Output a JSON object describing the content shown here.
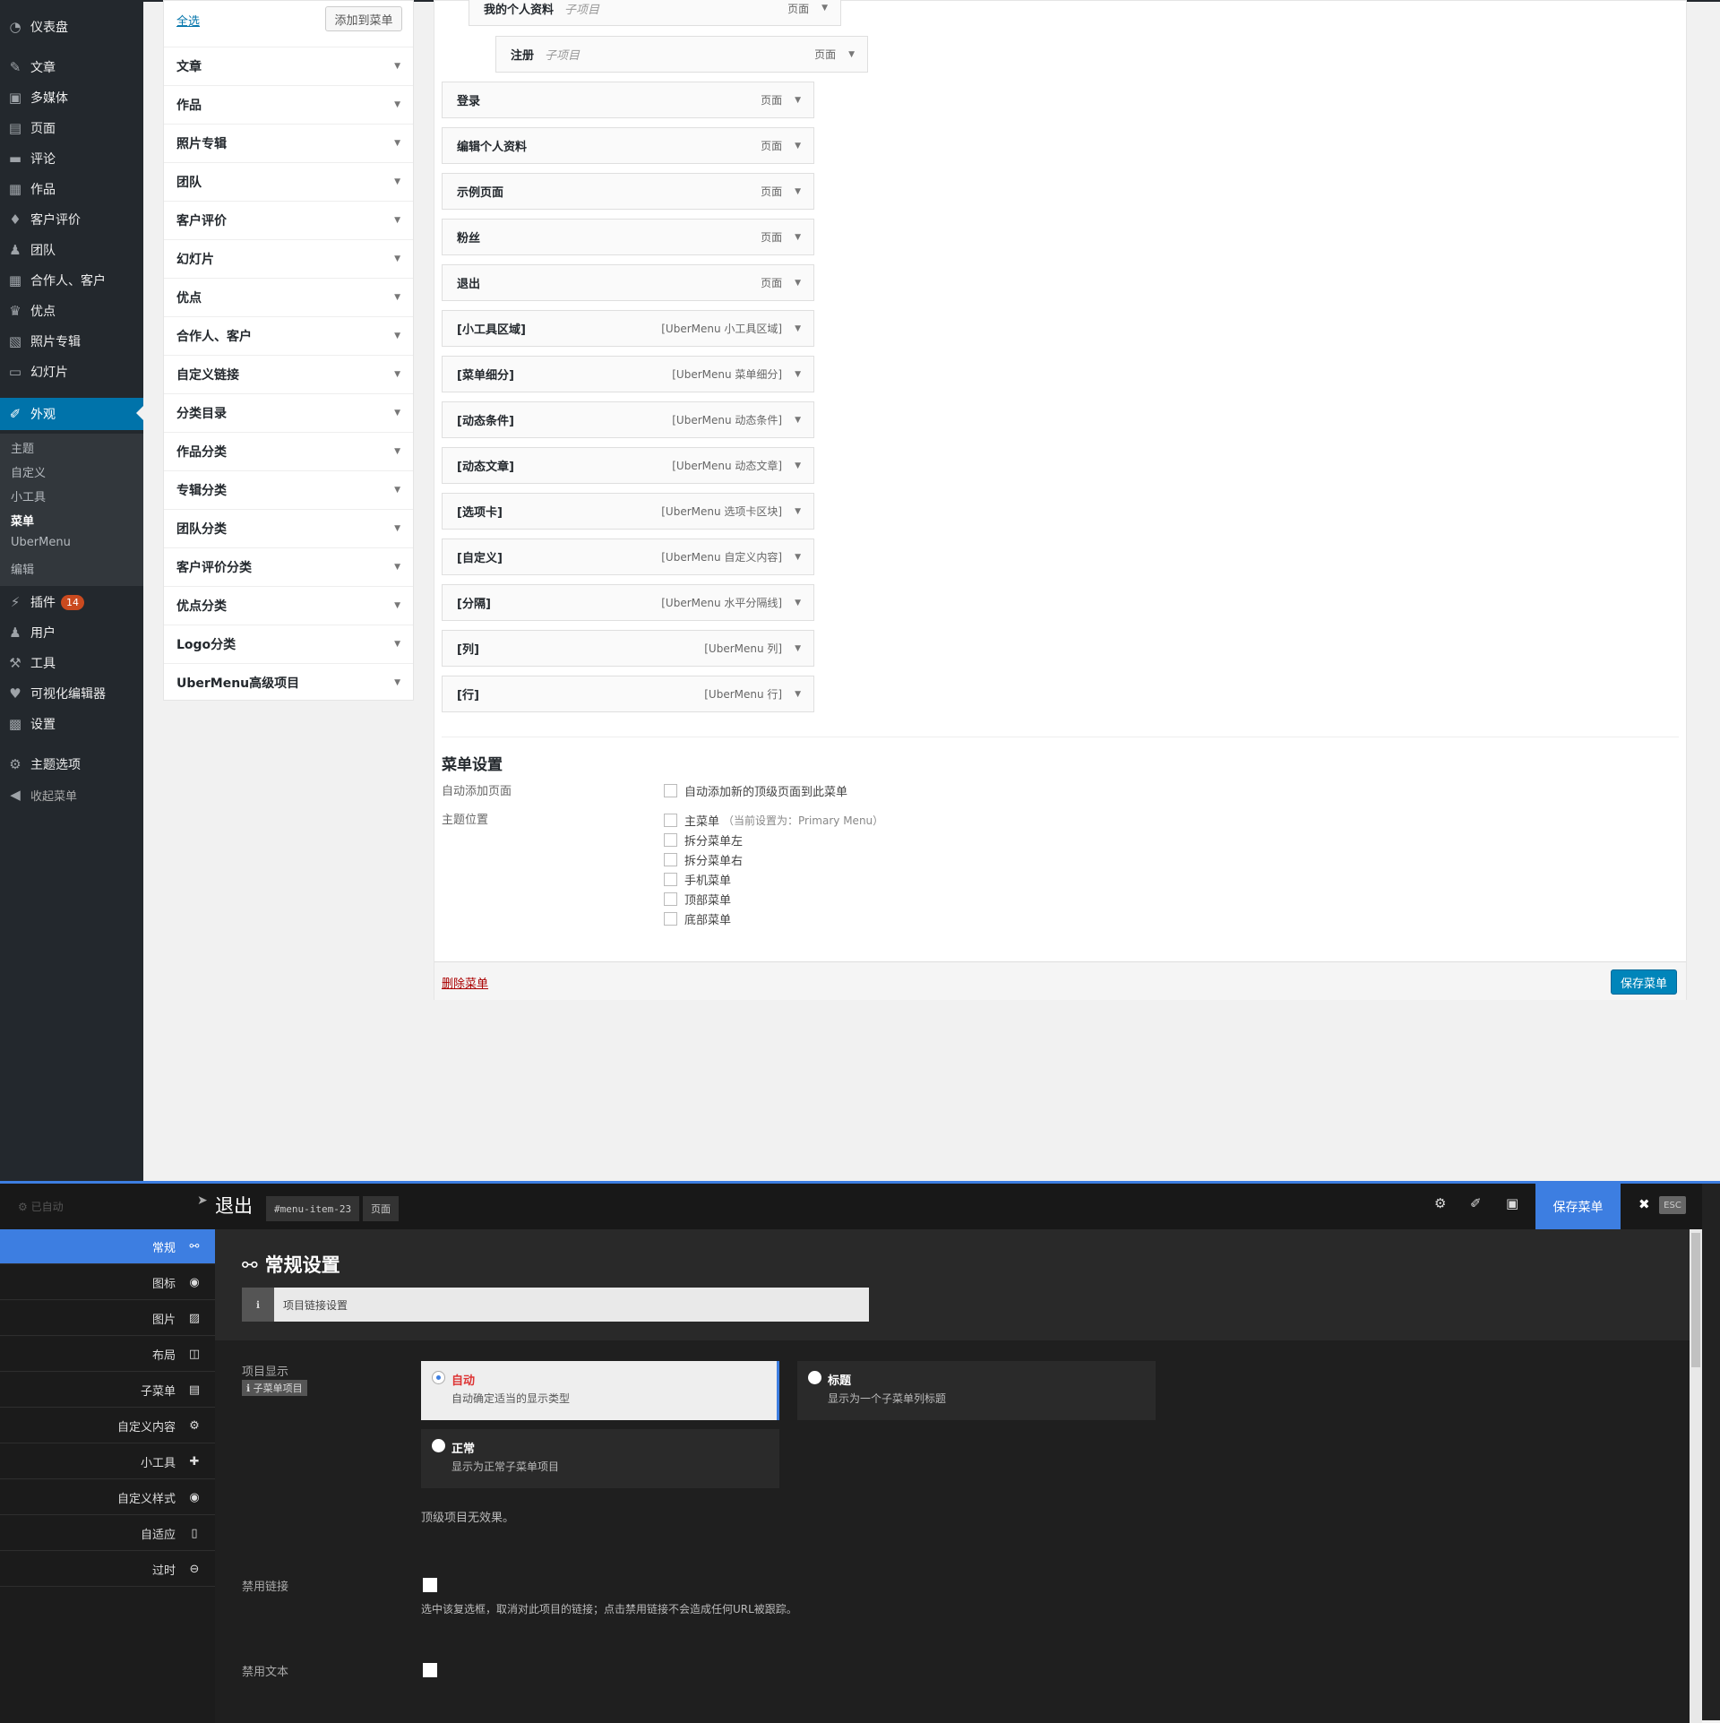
{
  "sidebar": {
    "items": [
      {
        "label": "仪表盘",
        "icon": "dashboard-icon",
        "glyph": "◔"
      },
      {
        "label": "文章",
        "icon": "pin-icon",
        "glyph": "✎"
      },
      {
        "label": "多媒体",
        "icon": "media-icon",
        "glyph": "▣"
      },
      {
        "label": "页面",
        "icon": "page-icon",
        "glyph": "▤"
      },
      {
        "label": "评论",
        "icon": "comment-icon",
        "glyph": "▬"
      },
      {
        "label": "作品",
        "icon": "portfolio-icon",
        "glyph": "▦"
      },
      {
        "label": "客户评价",
        "icon": "thumbs-up-icon",
        "glyph": "♦"
      },
      {
        "label": "团队",
        "icon": "team-icon",
        "glyph": "♟"
      },
      {
        "label": "合作人、客户",
        "icon": "grid-icon",
        "glyph": "▦"
      },
      {
        "label": "优点",
        "icon": "trophy-icon",
        "glyph": "♛"
      },
      {
        "label": "照片专辑",
        "icon": "gallery-icon",
        "glyph": "▧"
      },
      {
        "label": "幻灯片",
        "icon": "slides-icon",
        "glyph": "▭"
      },
      {
        "label": "外观",
        "icon": "brush-icon",
        "glyph": "✐"
      },
      {
        "label": "插件",
        "icon": "plugin-icon",
        "glyph": "⚡",
        "badge": "14"
      },
      {
        "label": "用户",
        "icon": "user-icon",
        "glyph": "♟"
      },
      {
        "label": "工具",
        "icon": "wrench-icon",
        "glyph": "⚒"
      },
      {
        "label": "可视化编辑器",
        "icon": "vc-icon",
        "glyph": "♥"
      },
      {
        "label": "设置",
        "icon": "settings-icon",
        "glyph": "▩"
      },
      {
        "label": "主题选项",
        "icon": "gear-icon",
        "glyph": "⚙"
      },
      {
        "label": "收起菜单",
        "icon": "collapse-icon",
        "glyph": "◀"
      }
    ],
    "submenu": [
      "主题",
      "自定义",
      "小工具",
      "菜单",
      "UberMenu",
      "编辑"
    ]
  },
  "left_panel": {
    "select_all": "全选",
    "add_button": "添加到菜单",
    "sections": [
      "文章",
      "作品",
      "照片专辑",
      "团队",
      "客户评价",
      "幻灯片",
      "优点",
      "合作人、客户",
      "自定义链接",
      "分类目录",
      "作品分类",
      "专辑分类",
      "团队分类",
      "客户评价分类",
      "优点分类",
      "Logo分类",
      "UberMenu高级项目"
    ]
  },
  "menu_items": [
    {
      "title": "我的个人资料",
      "sub": "子项目",
      "type": "页面"
    },
    {
      "title": "注册",
      "sub": "子项目",
      "type": "页面"
    },
    {
      "title": "登录",
      "sub": "",
      "type": "页面"
    },
    {
      "title": "编辑个人资料",
      "sub": "",
      "type": "页面"
    },
    {
      "title": "示例页面",
      "sub": "",
      "type": "页面"
    },
    {
      "title": "粉丝",
      "sub": "",
      "type": "页面"
    },
    {
      "title": "退出",
      "sub": "",
      "type": "页面"
    },
    {
      "title": "[小工具区域]",
      "sub": "",
      "type": "[UberMenu 小工具区域]"
    },
    {
      "title": "[菜单细分]",
      "sub": "",
      "type": "[UberMenu 菜单细分]"
    },
    {
      "title": "[动态条件]",
      "sub": "",
      "type": "[UberMenu 动态条件]"
    },
    {
      "title": "[动态文章]",
      "sub": "",
      "type": "[UberMenu 动态文章]"
    },
    {
      "title": "[选项卡]",
      "sub": "",
      "type": "[UberMenu 选项卡区块]"
    },
    {
      "title": "[自定义]",
      "sub": "",
      "type": "[UberMenu 自定义内容]"
    },
    {
      "title": "[分隔]",
      "sub": "",
      "type": "[UberMenu 水平分隔线]"
    },
    {
      "title": "[列]",
      "sub": "",
      "type": "[UberMenu 列]"
    },
    {
      "title": "[行]",
      "sub": "",
      "type": "[UberMenu 行]"
    }
  ],
  "menu_settings": {
    "title": "菜单设置",
    "auto_add_label": "自动添加页面",
    "auto_add_option": "自动添加新的顶级页面到此菜单",
    "location_label": "主题位置",
    "locations": [
      "主菜单",
      "拆分菜单左",
      "拆分菜单右",
      "手机菜单",
      "顶部菜单",
      "底部菜单"
    ],
    "primary_note": "（当前设置为：Primary Menu）",
    "delete_link": "删除菜单",
    "save_button": "保存菜单"
  },
  "ubermenu": {
    "top_left": "⚙ 已自动",
    "item_title": "退出",
    "item_id": "#menu-item-23",
    "item_type": "页面",
    "save_button": "保存菜单",
    "esc": "ESC",
    "tabs": [
      {
        "label": "常规",
        "icon": "link-icon",
        "glyph": "⚯"
      },
      {
        "label": "图标",
        "icon": "target-icon",
        "glyph": "◉"
      },
      {
        "label": "图片",
        "icon": "image-icon",
        "glyph": "▨"
      },
      {
        "label": "布局",
        "icon": "columns-icon",
        "glyph": "◫"
      },
      {
        "label": "子菜单",
        "icon": "list-icon",
        "glyph": "▤"
      },
      {
        "label": "自定义内容",
        "icon": "cogs-icon",
        "glyph": "⚙"
      },
      {
        "label": "小工具",
        "icon": "puzzle-icon",
        "glyph": "✚"
      },
      {
        "label": "自定义样式",
        "icon": "eye-icon",
        "glyph": "◉"
      },
      {
        "label": "自适应",
        "icon": "mobile-icon",
        "glyph": "▯"
      },
      {
        "label": "过时",
        "icon": "minus-circle-icon",
        "glyph": "⊖"
      }
    ],
    "section_title": "常规设置",
    "info_text": "项目链接设置",
    "display_label": "项目显示",
    "display_pill": "ℹ 子菜单项目",
    "options": [
      {
        "label": "自动",
        "desc": "自动确定适当的显示类型"
      },
      {
        "label": "标题",
        "desc": "显示为一个子菜单列标题"
      },
      {
        "label": "正常",
        "desc": "显示为正常子菜单项目"
      }
    ],
    "top_level_note": "顶级项目无效果。",
    "disable_link_label": "禁用链接",
    "disable_link_hint": "选中该复选框，取消对此项目的链接；点击禁用链接不会造成任何URL被跟踪。",
    "disable_text_label": "禁用文本"
  }
}
